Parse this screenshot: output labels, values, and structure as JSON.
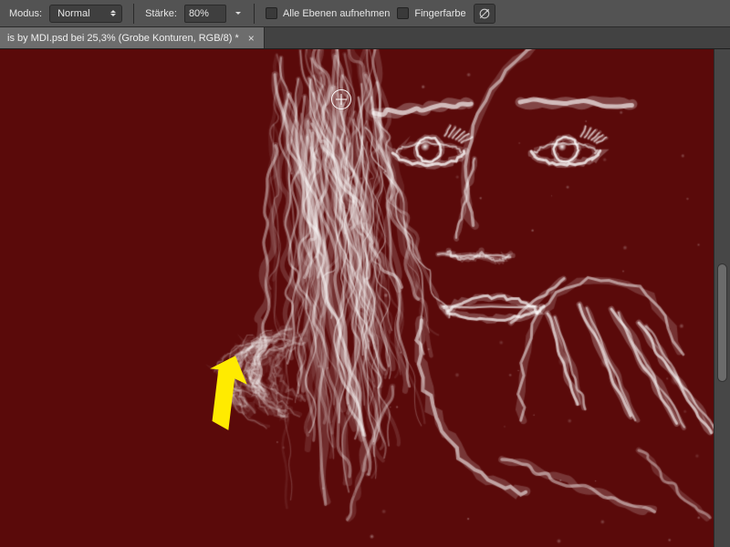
{
  "options_bar": {
    "mode_label": "Modus:",
    "mode_value": "Normal",
    "strength_label": "Stärke:",
    "strength_value": "80%",
    "sample_all_label": "Alle Ebenen aufnehmen",
    "finger_paint_label": "Fingerfarbe"
  },
  "document_tab": {
    "title": "is by MDI.psd bei 25,3% (Grobe Konturen, RGB/8) *",
    "close_glyph": "×"
  },
  "canvas": {
    "background_color": "#5a0a0a",
    "stroke_color": "#ffffff"
  },
  "icons": {
    "tablet_pressure": "tablet-pressure-icon"
  },
  "annotation": {
    "arrow_color": "#ffeb00"
  }
}
